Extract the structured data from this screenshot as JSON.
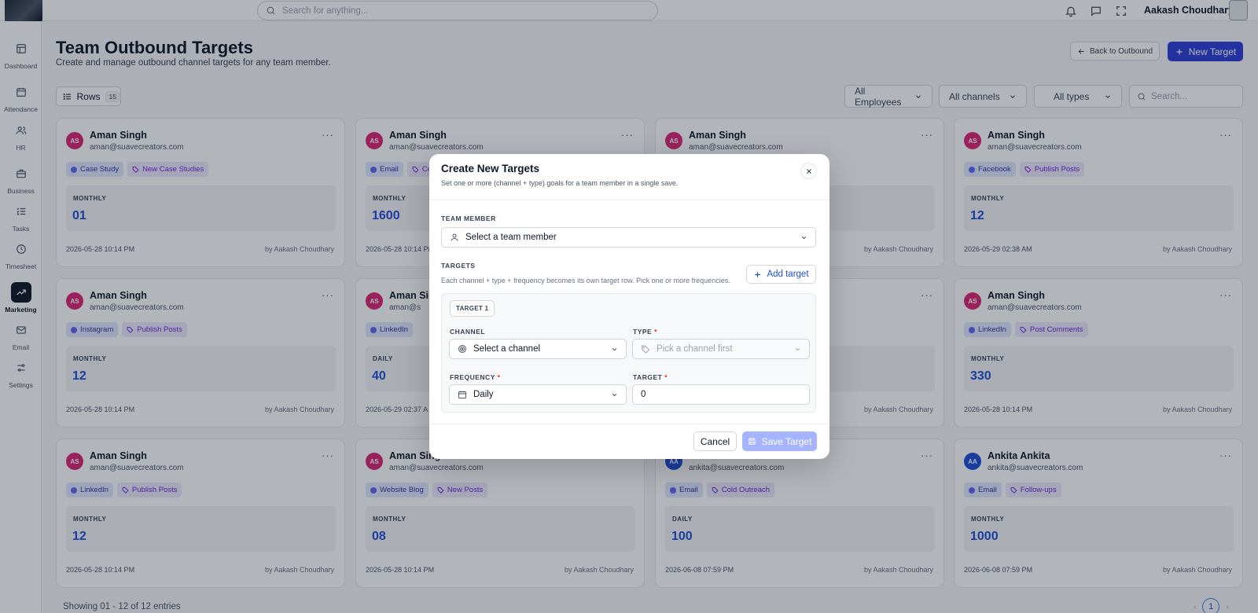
{
  "topbar": {
    "search_placeholder": "Search for anything...",
    "user_name": "Aakash Choudhary"
  },
  "sidebar": {
    "items": [
      {
        "label": "Dashboard",
        "icon": "layout-icon"
      },
      {
        "label": "Attendance",
        "icon": "calendar-icon"
      },
      {
        "label": "HR",
        "icon": "users-icon"
      },
      {
        "label": "Business",
        "icon": "briefcase-icon"
      },
      {
        "label": "Tasks",
        "icon": "list-check-icon"
      },
      {
        "label": "Timesheet",
        "icon": "clock-icon"
      },
      {
        "label": "Marketing",
        "icon": "trend-icon",
        "active": true
      },
      {
        "label": "Email",
        "icon": "mail-icon"
      },
      {
        "label": "Settings",
        "icon": "sliders-icon"
      }
    ]
  },
  "page": {
    "title": "Team Outbound Targets",
    "subtitle": "Create and manage outbound channel targets for any team member.",
    "back_label": "Back to Outbound",
    "new_label": "New Target",
    "rows_label": "Rows",
    "rows_count": "15",
    "filters": [
      "All Employees",
      "All channels",
      "All types"
    ],
    "search_placeholder": "Search...",
    "footer": "Showing 01 - 12 of 12 entries",
    "current_page": "1"
  },
  "cards": [
    {
      "initials": "AS",
      "name": "Aman Singh",
      "email": "aman@suavecreators.com",
      "channel": "Case Study",
      "type": "New Case Studies",
      "frequency": "MONTHLY",
      "value": "01",
      "date": "2026-05-28 10:14 PM",
      "by": "by Aakash Choudhary"
    },
    {
      "initials": "AS",
      "name": "Aman Singh",
      "email": "aman@suavecreators.com",
      "channel": "Email",
      "type": "Co",
      "frequency": "MONTHLY",
      "value": "1600",
      "date": "2026-05-28 10:14 PM",
      "by": "by Aakash Choudhary"
    },
    {
      "initials": "AS",
      "name": "Aman Singh",
      "email": "aman@suavecreators.com",
      "channel": "",
      "type": "",
      "frequency": "",
      "value": "",
      "date": "",
      "by": "by Aakash Choudhary"
    },
    {
      "initials": "AS",
      "name": "Aman Singh",
      "email": "aman@suavecreators.com",
      "channel": "Facebook",
      "type": "Publish Posts",
      "frequency": "MONTHLY",
      "value": "12",
      "date": "2026-05-29 02:38 AM",
      "by": "by Aakash Choudhary"
    },
    {
      "initials": "AS",
      "name": "Aman Singh",
      "email": "aman@suavecreators.com",
      "channel": "Instagram",
      "type": "Publish Posts",
      "frequency": "MONTHLY",
      "value": "12",
      "date": "2026-05-28 10:14 PM",
      "by": "by Aakash Choudhary"
    },
    {
      "initials": "AS",
      "name": "Aman Sin",
      "email": "aman@s",
      "channel": "LinkedIn",
      "type": "",
      "frequency": "DAILY",
      "value": "40",
      "date": "2026-05-29 02:37 A",
      "by": ""
    },
    {
      "initials": "AS",
      "name": "",
      "email": "",
      "channel": "",
      "type": "",
      "frequency": "",
      "value": "",
      "date": "",
      "by": "by Aakash Choudhary"
    },
    {
      "initials": "AS",
      "name": "Aman Singh",
      "email": "aman@suavecreators.com",
      "channel": "LinkedIn",
      "type": "Post Comments",
      "frequency": "MONTHLY",
      "value": "330",
      "date": "2026-05-28 10:14 PM",
      "by": "by Aakash Choudhary"
    },
    {
      "initials": "AS",
      "name": "Aman Singh",
      "email": "aman@suavecreators.com",
      "channel": "LinkedIn",
      "type": "Publish Posts",
      "frequency": "MONTHLY",
      "value": "12",
      "date": "2026-05-28 10:14 PM",
      "by": "by Aakash Choudhary"
    },
    {
      "initials": "AS",
      "name": "Aman Sing",
      "email": "aman@suavecreators.com",
      "channel": "Website Blog",
      "type": "New Posts",
      "frequency": "MONTHLY",
      "value": "08",
      "date": "2026-05-28 10:14 PM",
      "by": "by Aakash Choudhary"
    },
    {
      "initials": "AA",
      "name": "",
      "email": "ankita@suavecreators.com",
      "channel": "Email",
      "type": "Cold Outreach",
      "frequency": "DAILY",
      "value": "100",
      "date": "2026-06-08 07:59 PM",
      "by": "by Aakash Choudhary"
    },
    {
      "initials": "AA",
      "name": "Ankita Ankita",
      "email": "ankita@suavecreators.com",
      "channel": "Email",
      "type": "Follow-ups",
      "frequency": "MONTHLY",
      "value": "1000",
      "date": "2026-06-08 07:59 PM",
      "by": "by Aakash Choudhary"
    }
  ],
  "modal": {
    "title": "Create New Targets",
    "subtitle": "Set one or more (channel + type) goals for a team member in a single save.",
    "team_member_label": "TEAM MEMBER",
    "team_member_placeholder": "Select a team member",
    "targets_label": "TARGETS",
    "targets_help": "Each channel + type + frequency becomes its own target row. Pick one or more frequencies.",
    "add_target_label": "Add target",
    "target_badge": "TARGET 1",
    "channel_label": "CHANNEL",
    "channel_placeholder": "Select a channel",
    "type_label": "TYPE",
    "type_placeholder": "Pick a channel first",
    "frequency_label": "FREQUENCY",
    "frequency_value": "Daily",
    "target_label": "TARGET",
    "target_value": "0",
    "required_mark": "*",
    "cancel_label": "Cancel",
    "save_label": "Save Target"
  },
  "colors": {
    "accent": "#2f3fd8",
    "avatar_pink": "#db2777",
    "avatar_blue": "#1d4ed8",
    "value_blue": "#1d4ed8"
  }
}
